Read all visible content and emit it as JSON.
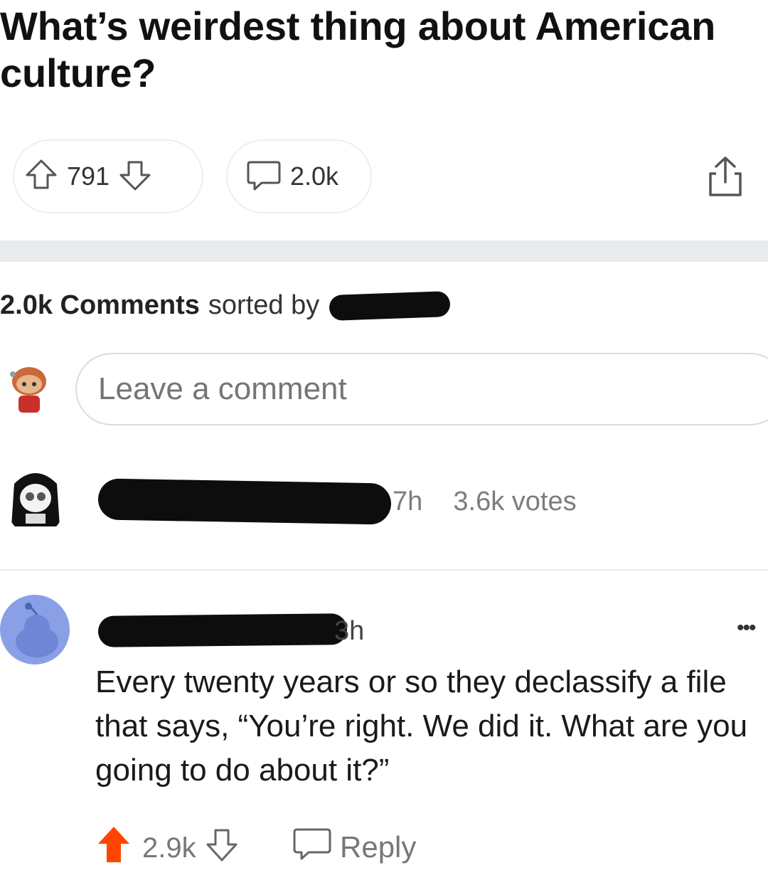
{
  "post": {
    "title": "What’s weirdest thing about American culture?",
    "vote_count": "791",
    "comment_count": "2.0k"
  },
  "comments_header": {
    "count": "2.0k",
    "label": "Comments",
    "sorted_by": "sorted by"
  },
  "comment_box": {
    "placeholder": "Leave a comment"
  },
  "comments": [
    {
      "time_fragment": "7h",
      "votes": "3.6k votes"
    },
    {
      "time_fragment": "3h",
      "more": "•••",
      "body": "Every twenty years or so they declassify a file that says, “You’re right. We did it. What are you going to do about it?”",
      "score": "2.9k",
      "reply_label": "Reply"
    }
  ],
  "colors": {
    "upvote_active": "#ff4500",
    "icon_gray": "#666666",
    "band": "#e8eaed"
  },
  "icons": [
    "upvote-icon",
    "downvote-icon",
    "comment-bubble-icon",
    "share-icon",
    "more-icon",
    "reply-bubble-icon"
  ]
}
